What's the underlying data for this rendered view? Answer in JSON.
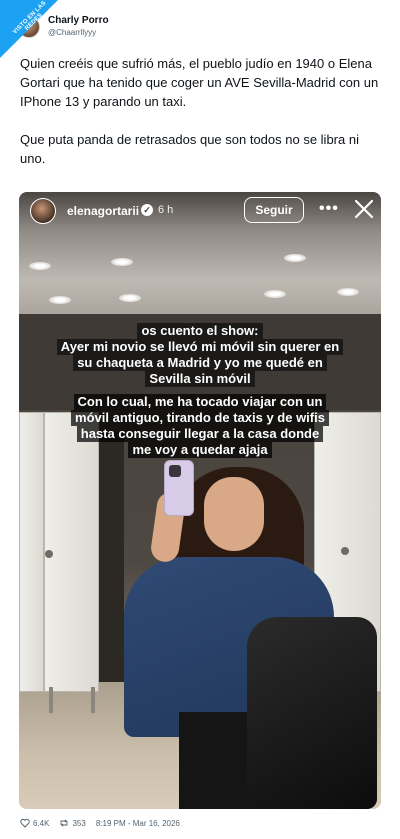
{
  "watermark": {
    "text": "VISTO EN LAS REDES"
  },
  "author": {
    "display_name": "Charly Porro",
    "handle": "@Chaarrllyyy"
  },
  "tweet": {
    "paragraph1": "Quien creéis que sufrió más, el pueblo judío en 1940 o Elena Gortari que ha tenido que coger un AVE Sevilla-Madrid con un IPhone 13 y parando un taxi.",
    "paragraph2": "Que puta panda de retrasados que son todos no se libra ni uno."
  },
  "story": {
    "username": "elenagortarii",
    "time": "6 h",
    "follow_label": "Seguir",
    "caption1": [
      "os cuento el show:",
      "Ayer mi novio se llevó mi móvil sin querer en",
      "su chaqueta a Madrid y yo me quedé en",
      "Sevilla sin móvil"
    ],
    "caption2": [
      "Con lo cual, me ha tocado viajar con un",
      "móvil antiguo, tirando de taxis y de wifis",
      "hasta conseguir llegar a la casa donde",
      "me voy a quedar ajaja"
    ]
  },
  "footer": {
    "likes": "6.4K",
    "retweets": "353",
    "timestamp": "8:19 PM - Mar 16, 2026"
  },
  "icons": [
    "verified-icon",
    "more-icon",
    "close-icon",
    "heart-icon",
    "retweet-icon"
  ]
}
